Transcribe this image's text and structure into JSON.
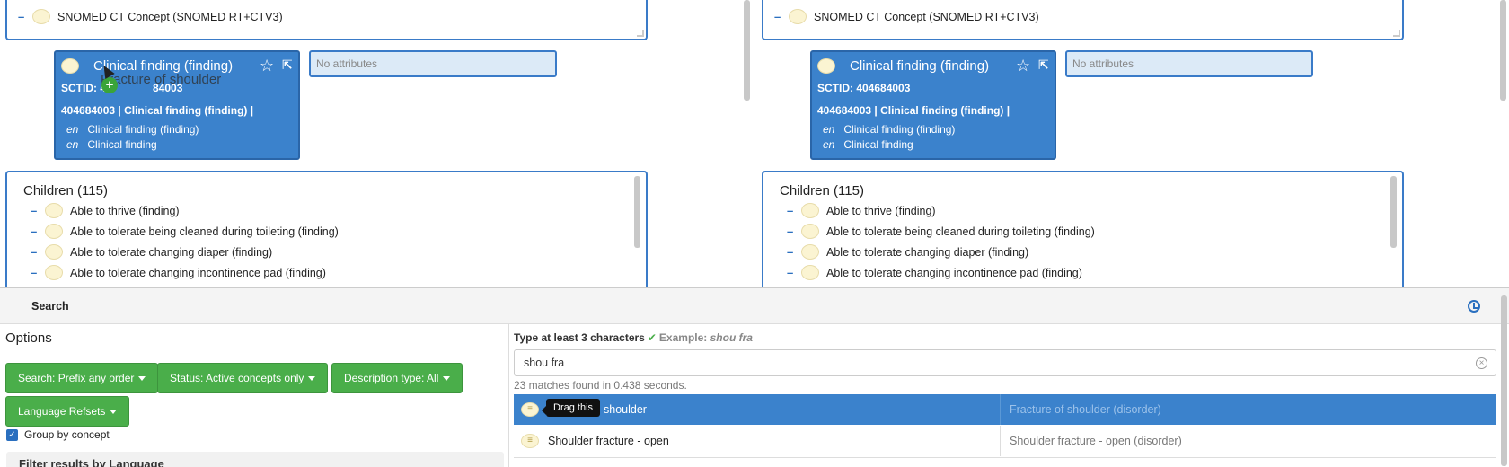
{
  "panes": {
    "root_concept": "SNOMED CT Concept (SNOMED RT+CTV3)",
    "card": {
      "title": "Clinical finding (finding)",
      "sctid_label": "SCTID: 404684003",
      "sctid_obscured": "SCTID: 4",
      "sctid_obscured_tail": "84003",
      "fsn_line": "404684003 | Clinical finding (finding) |",
      "descriptions": [
        {
          "lang": "en",
          "term": "Clinical finding (finding)"
        },
        {
          "lang": "en",
          "term": "Clinical finding"
        }
      ],
      "star_icon": "☆",
      "open_icon": "⇱"
    },
    "attributes_placeholder": "No attributes",
    "drag_ghost_text": "Fracture of shoulder",
    "drag_plus": "+",
    "children_title": "Children (115)",
    "children": [
      "Able to thrive (finding)",
      "Able to tolerate being cleaned during toileting (finding)",
      "Able to tolerate changing diaper (finding)",
      "Able to tolerate changing incontinence pad (finding)"
    ]
  },
  "search": {
    "header_label": "Search",
    "options_title": "Options",
    "buttons": {
      "search_mode": "Search: Prefix any order",
      "status": "Status: Active concepts only",
      "description_type": "Description type: All",
      "language_refsets": "Language Refsets"
    },
    "group_by_concept": "Group by concept",
    "filter_heading": "Filter results by Language",
    "hint": "Type at least 3 characters",
    "hint_example_label": "Example:",
    "hint_example": "shou fra",
    "query": "shou fra",
    "matches": "23 matches found in 0.438 seconds.",
    "tooltip": "Drag this",
    "results": [
      {
        "term": "shoulder",
        "fsn": "Fracture of shoulder (disorder)",
        "selected": true
      },
      {
        "term": "Shoulder fracture - open",
        "fsn": "Shoulder fracture - open (disorder)",
        "selected": false
      }
    ]
  }
}
